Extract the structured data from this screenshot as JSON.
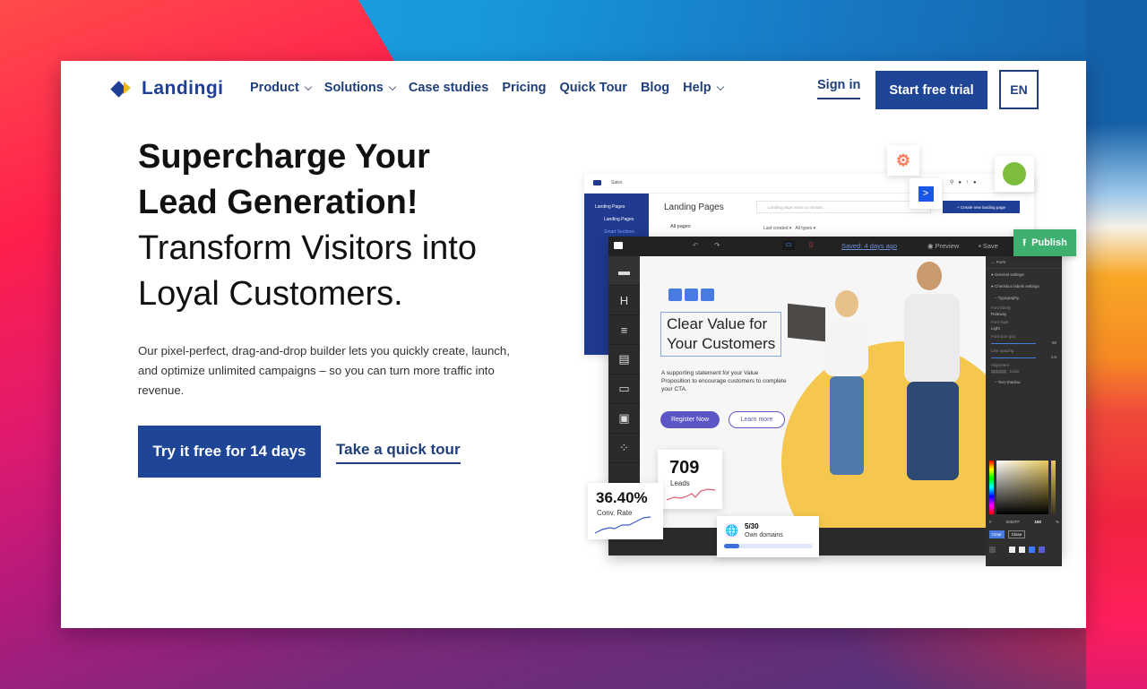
{
  "brand": {
    "name": "Landingi",
    "primary_color": "#1f4596",
    "accent_color": "#f5b323"
  },
  "nav": {
    "items": [
      {
        "label": "Product",
        "has_dropdown": true
      },
      {
        "label": "Solutions",
        "has_dropdown": true
      },
      {
        "label": "Case studies",
        "has_dropdown": false
      },
      {
        "label": "Pricing",
        "has_dropdown": false
      },
      {
        "label": "Quick Tour",
        "has_dropdown": false
      },
      {
        "label": "Blog",
        "has_dropdown": false
      },
      {
        "label": "Help",
        "has_dropdown": true
      }
    ],
    "sign_in": "Sign in",
    "start_trial": "Start free trial",
    "language": "EN"
  },
  "hero": {
    "headline_bold_1": "Supercharge Your",
    "headline_bold_2": "Lead Generation!",
    "headline_light_1": "Transform Visitors into",
    "headline_light_2": "Loyal Customers.",
    "description": "Our pixel-perfect, drag-and-drop builder lets you quickly create, launch, and optimize unlimited campaigns – so you can turn more traffic into revenue.",
    "cta_primary": "Try it free for 14 days",
    "cta_secondary": "Take a quick tour"
  },
  "mockup": {
    "dashboard": {
      "workspace": "Sales",
      "title": "Landing Pages",
      "search_placeholder": "Landing page name or domain...",
      "create_button": "+ Create new landing page",
      "all_pages": "All pages",
      "sort": "Last created",
      "filter": "All types",
      "sidebar": [
        "Landing Pages",
        "Landing Pages",
        "Smart Sections"
      ]
    },
    "editor": {
      "saved_status": "Saved: 4 days ago",
      "preview": "Preview",
      "save": "Save",
      "publish": "Publish",
      "canvas_headline_1": "Clear Value for",
      "canvas_headline_2": "Your Customers",
      "canvas_text": "A supporting statement for your Value Proposition to encourage customers to complete your CTA.",
      "canvas_primary_btn": "Register Now",
      "canvas_secondary_btn": "Learn more",
      "panel": {
        "title": "Form",
        "items": [
          "General settings",
          "Checkbox labels settings",
          "Typography"
        ],
        "font_family_label": "Font family",
        "font_family_value": "Raleway",
        "font_style_label": "Font style",
        "font_style_value": "Light",
        "font_size_label": "Font size (px)",
        "font_size_value": "50",
        "line_spacing_label": "Line spacing",
        "line_spacing_value": "1.6",
        "alignment_label": "Alignment",
        "color_label": "Color",
        "text_shadow_label": "Text shadow",
        "hex_value": "5082FF",
        "opacity_value": "100",
        "clear_btn": "Clear",
        "close_btn": "Close"
      }
    },
    "stats": {
      "leads_value": "709",
      "leads_label": "Leads",
      "conv_value": "36.40%",
      "conv_label": "Conv. Rate",
      "domains_value": "5/30",
      "domains_label": "Own domains",
      "domains_progress": 0.17
    }
  }
}
